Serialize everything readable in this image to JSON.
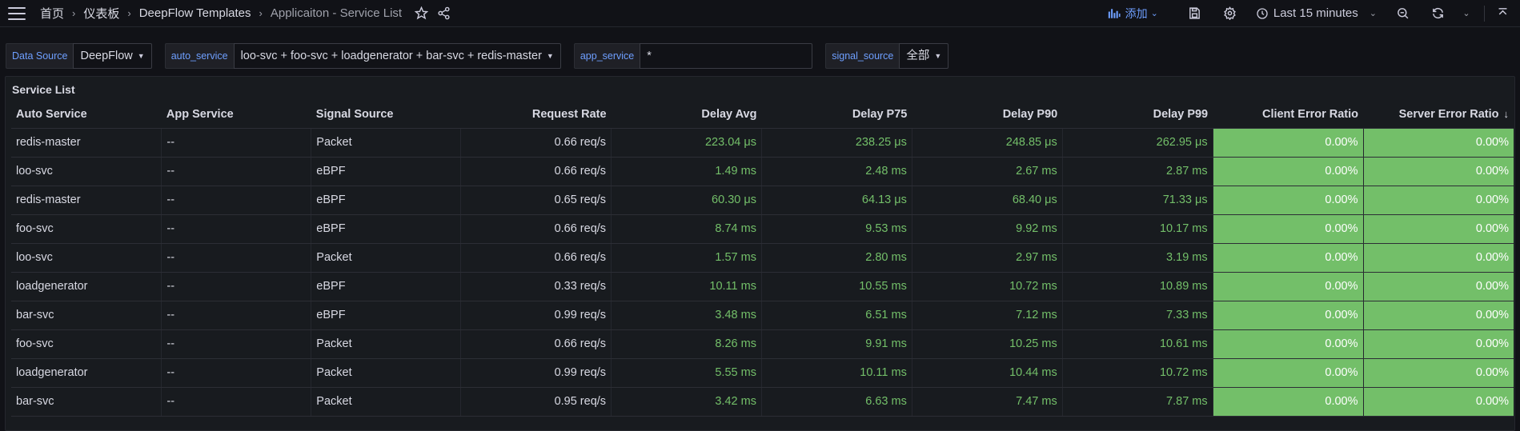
{
  "nav": {
    "breadcrumbs": [
      "首页",
      "仪表板",
      "DeepFlow Templates",
      "Applicaiton - Service List"
    ],
    "add_label": "添加",
    "time_range": "Last 15 minutes"
  },
  "variables": [
    {
      "label": "Data Source",
      "value": "DeepFlow"
    },
    {
      "label": "auto_service",
      "value": "loo-svc + foo-svc + loadgenerator + bar-svc + redis-master"
    },
    {
      "label": "app_service",
      "value": "*"
    },
    {
      "label": "signal_source",
      "value": "全部"
    }
  ],
  "panel": {
    "title": "Service List",
    "columns": [
      "Auto Service",
      "App Service",
      "Signal Source",
      "Request Rate",
      "Delay Avg",
      "Delay P75",
      "Delay P90",
      "Delay P99",
      "Client Error Ratio",
      "Server Error Ratio"
    ],
    "rows": [
      [
        "redis-master",
        "--",
        "Packet",
        "0.66 req/s",
        "223.04 μs",
        "238.25 μs",
        "248.85 μs",
        "262.95 μs",
        "0.00%",
        "0.00%"
      ],
      [
        "loo-svc",
        "--",
        "eBPF",
        "0.66 req/s",
        "1.49 ms",
        "2.48 ms",
        "2.67 ms",
        "2.87 ms",
        "0.00%",
        "0.00%"
      ],
      [
        "redis-master",
        "--",
        "eBPF",
        "0.65 req/s",
        "60.30 μs",
        "64.13 μs",
        "68.40 μs",
        "71.33 μs",
        "0.00%",
        "0.00%"
      ],
      [
        "foo-svc",
        "--",
        "eBPF",
        "0.66 req/s",
        "8.74 ms",
        "9.53 ms",
        "9.92 ms",
        "10.17 ms",
        "0.00%",
        "0.00%"
      ],
      [
        "loo-svc",
        "--",
        "Packet",
        "0.66 req/s",
        "1.57 ms",
        "2.80 ms",
        "2.97 ms",
        "3.19 ms",
        "0.00%",
        "0.00%"
      ],
      [
        "loadgenerator",
        "--",
        "eBPF",
        "0.33 req/s",
        "10.11 ms",
        "10.55 ms",
        "10.72 ms",
        "10.89 ms",
        "0.00%",
        "0.00%"
      ],
      [
        "bar-svc",
        "--",
        "eBPF",
        "0.99 req/s",
        "3.48 ms",
        "6.51 ms",
        "7.12 ms",
        "7.33 ms",
        "0.00%",
        "0.00%"
      ],
      [
        "foo-svc",
        "--",
        "Packet",
        "0.66 req/s",
        "8.26 ms",
        "9.91 ms",
        "10.25 ms",
        "10.61 ms",
        "0.00%",
        "0.00%"
      ],
      [
        "loadgenerator",
        "--",
        "Packet",
        "0.99 req/s",
        "5.55 ms",
        "10.11 ms",
        "10.44 ms",
        "10.72 ms",
        "0.00%",
        "0.00%"
      ],
      [
        "bar-svc",
        "--",
        "Packet",
        "0.95 req/s",
        "3.42 ms",
        "6.63 ms",
        "7.47 ms",
        "7.87 ms",
        "0.00%",
        "0.00%"
      ]
    ],
    "sort_indicator": "↓"
  },
  "colors": {
    "accent": "#6e9fff",
    "value_green": "#73bf69",
    "background": "#111217"
  }
}
